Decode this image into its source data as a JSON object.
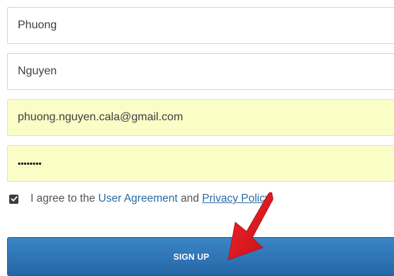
{
  "form": {
    "first_name": "Phuong",
    "last_name": "Nguyen",
    "email": "phuong.nguyen.cala@gmail.com",
    "password_masked": "••••••••",
    "agree": {
      "checked": true,
      "text_prefix": "I agree to the ",
      "user_agreement_link": "User Agreement",
      "text_middle": " and ",
      "privacy_policy_link": "Privacy Policy",
      "text_suffix": "."
    },
    "signup_label": "SIGN UP"
  },
  "colors": {
    "autofill_background": "#fafdc6",
    "link": "#2d6ba3",
    "button": "#2f74b5",
    "annotation_arrow": "#e8141e"
  },
  "icons": [
    "checkmark-icon",
    "red-arrow-annotation"
  ]
}
